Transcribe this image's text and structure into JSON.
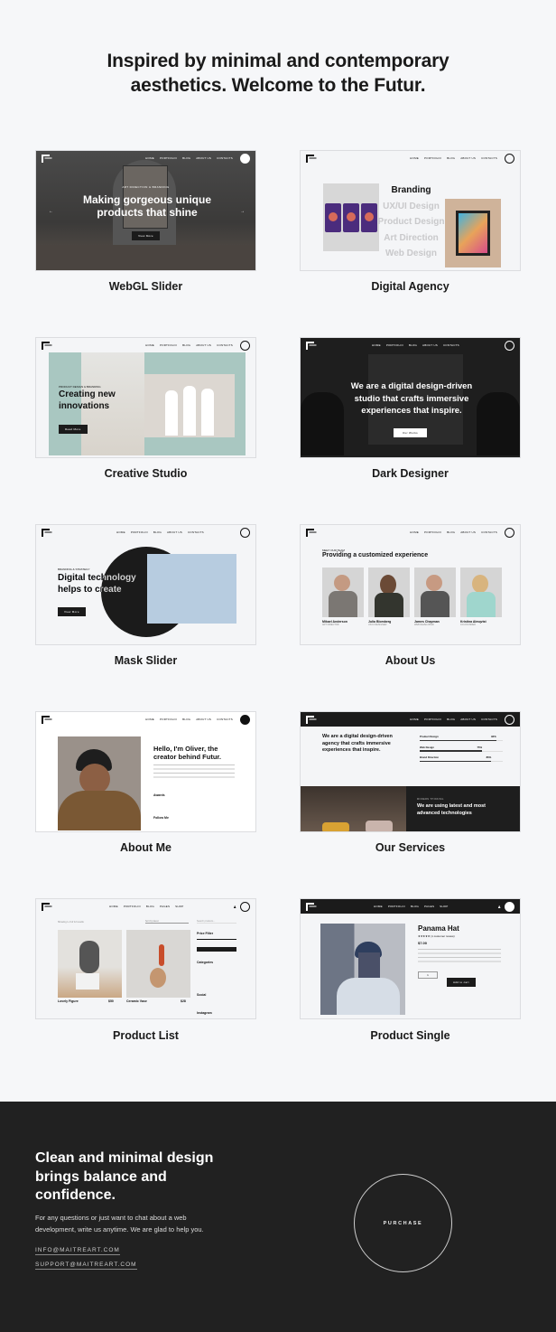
{
  "headline": [
    "Inspired by minimal and contemporary",
    "aesthetics. Welcome to the Futur."
  ],
  "nav_default": [
    "Home",
    "Portfolio",
    "Blog",
    "About Us",
    "Contacts"
  ],
  "nav_shop": [
    "Home",
    "Portfolio",
    "Blog",
    "Pages",
    "Shop"
  ],
  "demos": [
    {
      "caption": "WebGL Slider",
      "eyebrow": "Art Direction & Branding",
      "title": "Making gorgeous unique products that shine",
      "button": "View More"
    },
    {
      "caption": "Digital Agency",
      "services": [
        "Branding",
        "UX/UI Design",
        "Product Design",
        "Art Direction",
        "Web Design"
      ]
    },
    {
      "caption": "Creative Studio",
      "eyebrow": "Product Design & Branding",
      "title": "Creating new innovations",
      "button": "Read More"
    },
    {
      "caption": "Dark Designer",
      "title": "We are a digital design-driven studio that crafts immersive experiences that inspire.",
      "button": "Our Works"
    },
    {
      "caption": "Mask Slider",
      "eyebrow": "Branding & Strategy",
      "title": "Digital technology helps to create",
      "button": "View More"
    },
    {
      "caption": "About Us",
      "eyebrow": "Meet Our Team",
      "title": "Providing a customized experience",
      "team": [
        {
          "name": "Mikael Anderson",
          "role": "Art Director"
        },
        {
          "name": "Julia Blomberg",
          "role": "Ux/UI Designer"
        },
        {
          "name": "James Chapman",
          "role": "Web Developer"
        },
        {
          "name": "Kristina Almqvist",
          "role": "Co-Founder"
        }
      ]
    },
    {
      "caption": "About Me",
      "title": "Hello, I'm Oliver, the creator behind Futur.",
      "awards_label": "Awards",
      "follow_label": "Follow Me"
    },
    {
      "caption": "Our Services",
      "title": "We are a digital design-driven agency that crafts immersive experiences that inspire.",
      "skills": [
        {
          "label": "Product Design",
          "value": 92
        },
        {
          "label": "Web Design",
          "value": 75
        },
        {
          "label": "Brand Direction",
          "value": 86
        }
      ],
      "eyebrow2": "Modern Thinking",
      "title2": "We are using latest and most advanced technologies"
    },
    {
      "caption": "Product List",
      "results": "Showing 1–9 of 12 results",
      "sort": "Sort by latest",
      "search": "Search products...",
      "products": [
        {
          "name": "Lovely Figure",
          "price": "$50"
        },
        {
          "name": "Ceramic Vase",
          "price": "$28"
        }
      ],
      "sidebar": [
        "Price Filter",
        "Categories",
        "Social",
        "Instagram"
      ]
    },
    {
      "caption": "Product Single",
      "title": "Panama Hat",
      "reviews": "(1 customer review)",
      "price": "$7.00",
      "button": "Add to cart",
      "qty": "1"
    }
  ],
  "footer": {
    "title": "Clean and minimal design brings balance and confidence.",
    "text": "For any questions or just want to chat about a web development, write us anytime. We are glad to help you.",
    "email1": "INFO@MAITREART.COM",
    "email2": "SUPPORT@MAITREART.COM",
    "purchase": "PURCHASE"
  }
}
